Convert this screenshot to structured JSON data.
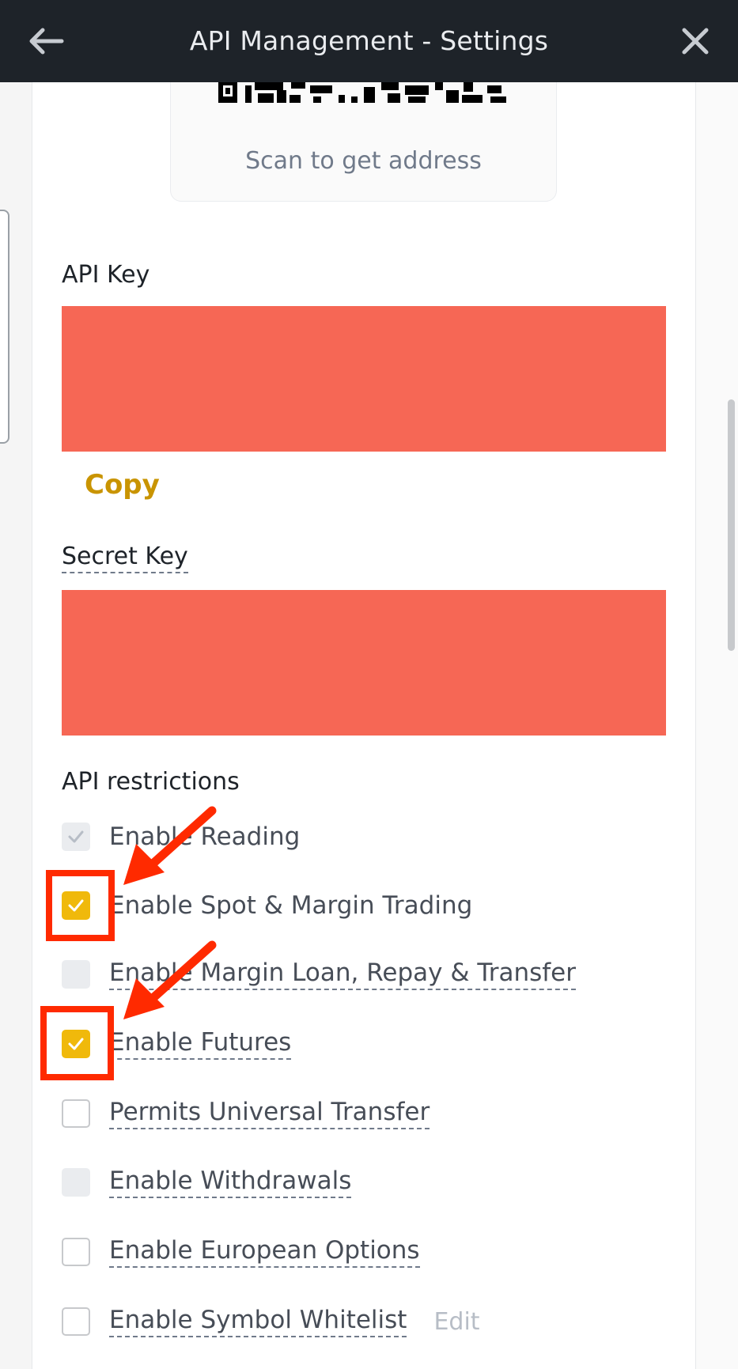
{
  "header": {
    "title": "API Management - Settings",
    "back_icon": "arrow-left-icon",
    "close_icon": "close-icon"
  },
  "qr": {
    "caption": "Scan to get address"
  },
  "api_key": {
    "label": "API Key",
    "copy_label": "Copy"
  },
  "secret_key": {
    "label": "Secret Key"
  },
  "restrictions": {
    "title": "API restrictions",
    "items": [
      {
        "label": "Enable Reading",
        "state": "disabled-checked",
        "dashed": false
      },
      {
        "label": "Enable Spot & Margin Trading",
        "state": "checked",
        "dashed": false
      },
      {
        "label": "Enable Margin Loan, Repay & Transfer",
        "state": "disabled-unchecked",
        "dashed": true
      },
      {
        "label": "Enable Futures",
        "state": "checked",
        "dashed": true
      },
      {
        "label": "Permits Universal Transfer",
        "state": "unchecked",
        "dashed": true
      },
      {
        "label": "Enable Withdrawals",
        "state": "disabled-unchecked",
        "dashed": true
      },
      {
        "label": "Enable European Options",
        "state": "unchecked",
        "dashed": true
      },
      {
        "label": "Enable Symbol Whitelist",
        "state": "unchecked",
        "dashed": true
      }
    ],
    "edit_label": "Edit"
  },
  "colors": {
    "header_bg": "#1e2329",
    "accent": "#f0b90b",
    "copy_text": "#c99400",
    "redaction": "#f66755",
    "annotation": "#ff2a00"
  }
}
